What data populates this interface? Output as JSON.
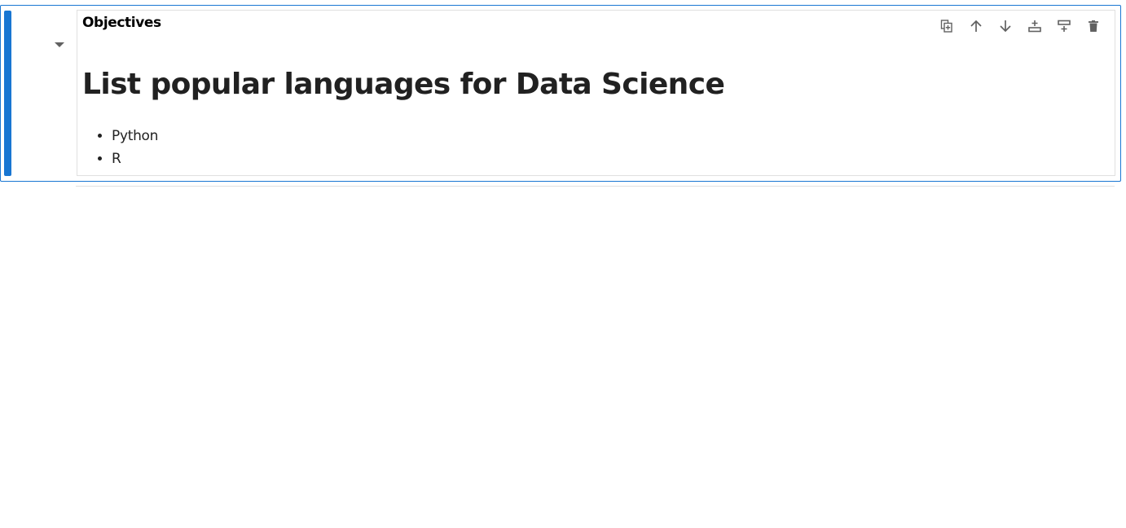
{
  "cell": {
    "title": "Objectives",
    "heading": "List popular languages for Data Science",
    "list_items": [
      "Python",
      "R"
    ]
  },
  "toolbar": {
    "duplicate_icon": "duplicate-icon",
    "move_up_icon": "arrow-up-icon",
    "move_down_icon": "arrow-down-icon",
    "insert_above_icon": "insert-above-icon",
    "insert_below_icon": "insert-below-icon",
    "delete_icon": "trash-icon"
  },
  "colors": {
    "accent": "#1976d2",
    "border": "#e0e0e0",
    "icon": "#616161",
    "text": "#212121"
  }
}
